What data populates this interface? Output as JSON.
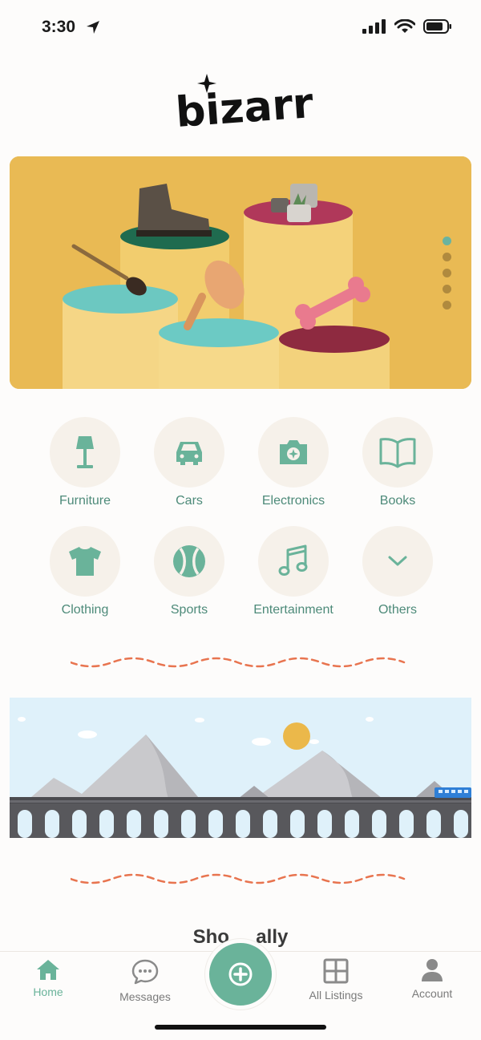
{
  "status_bar": {
    "time": "3:30"
  },
  "logo": {
    "text": "bizarr"
  },
  "hero": {
    "slide_count": 5,
    "active_slide": 1
  },
  "categories": [
    {
      "id": "furniture",
      "label": "Furniture",
      "icon": "lamp-icon"
    },
    {
      "id": "cars",
      "label": "Cars",
      "icon": "car-icon"
    },
    {
      "id": "electronics",
      "label": "Electronics",
      "icon": "camera-icon"
    },
    {
      "id": "books",
      "label": "Books",
      "icon": "book-icon"
    },
    {
      "id": "clothing",
      "label": "Clothing",
      "icon": "tshirt-icon"
    },
    {
      "id": "sports",
      "label": "Sports",
      "icon": "ball-icon"
    },
    {
      "id": "entertainment",
      "label": "Entertainment",
      "icon": "music-note-icon"
    },
    {
      "id": "others",
      "label": "Others",
      "icon": "chevron-down-icon"
    }
  ],
  "section": {
    "title": "Sho ... ally"
  },
  "tab_bar": {
    "home": "Home",
    "messages": "Messages",
    "all_listings": "All Listings",
    "account": "Account",
    "active": "home"
  },
  "colors": {
    "accent": "#6ab39a",
    "label": "#4d8a79",
    "circle": "#f6f1ea",
    "wave": "#e8744f",
    "hero_bg": "#e6b650"
  }
}
